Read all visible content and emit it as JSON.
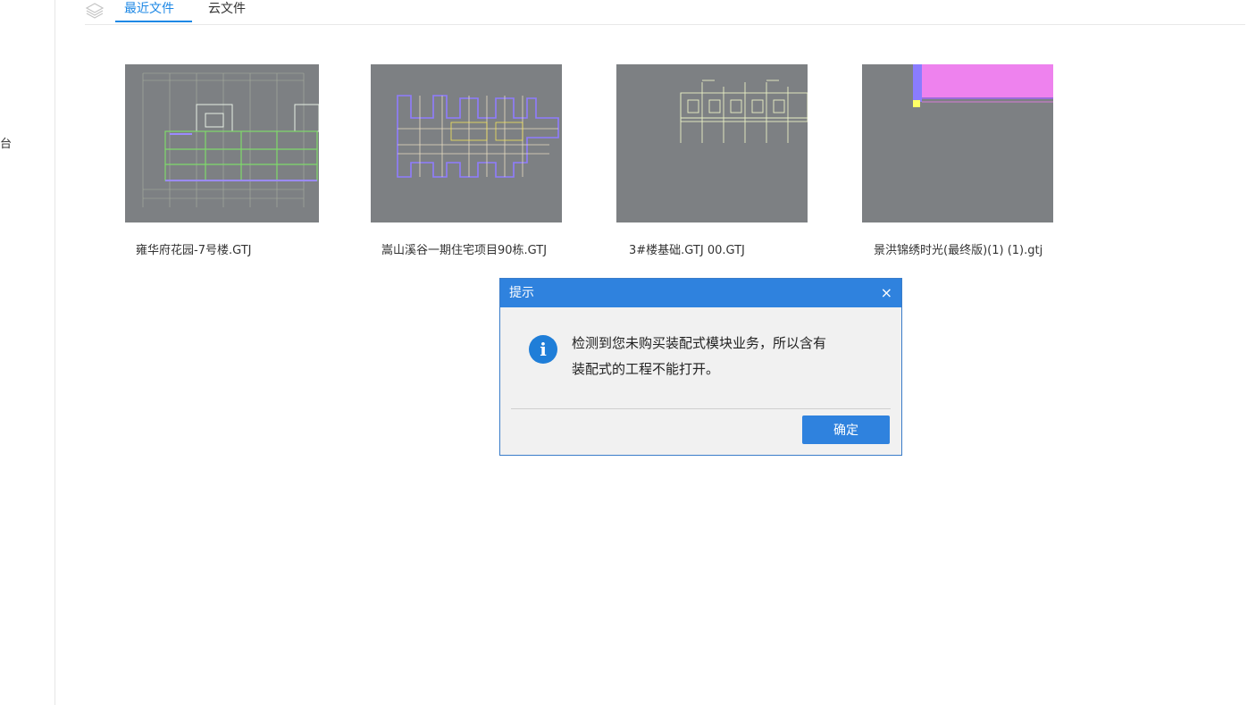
{
  "sidebar": {
    "visible_fragment": "台"
  },
  "tabs": [
    {
      "label": "最近文件",
      "active": true
    },
    {
      "label": "云文件",
      "active": false
    }
  ],
  "files": [
    {
      "name": "雍华府花园-7号楼.GTJ"
    },
    {
      "name": "嵩山溪谷一期住宅项目90栋.GTJ"
    },
    {
      "name": "3#楼基础.GTJ   00.GTJ"
    },
    {
      "name": "景洪锦绣时光(最终版)(1) (1).gtj"
    }
  ],
  "dialog": {
    "title": "提示",
    "message_line1": "检测到您未购买装配式模块业务，所以含有",
    "message_line2": "装配式的工程不能打开。",
    "ok_label": "确定",
    "close_glyph": "×",
    "info_glyph": "i"
  },
  "colors": {
    "accent": "#1e88e5",
    "dialog_title_bg": "#2f82de",
    "thumbnail_bg": "#7d8083",
    "magenta_fill": "#ee82ee"
  }
}
